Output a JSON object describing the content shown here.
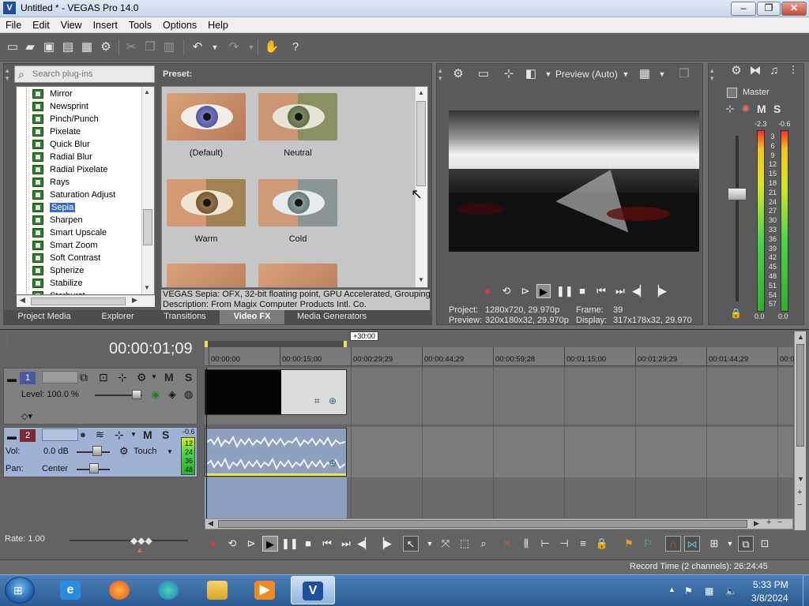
{
  "window": {
    "title": "Untitled * - VEGAS Pro 14.0",
    "app_icon": "vegas-icon",
    "minimize": "–",
    "maximize": "❐",
    "close": "✕"
  },
  "menu": [
    "File",
    "Edit",
    "View",
    "Insert",
    "Tools",
    "Options",
    "Help"
  ],
  "toolbar": {
    "icons": [
      "new-icon",
      "open-icon",
      "save-icon",
      "save-as-icon",
      "render-icon",
      "properties-icon",
      "cut-icon",
      "copy-icon",
      "paste-icon",
      "undo-icon",
      "redo-icon",
      "split-icon",
      "help-icon"
    ]
  },
  "plugins": {
    "search_placeholder": "Search plug-ins",
    "items": [
      "Mirror",
      "Newsprint",
      "Pinch/Punch",
      "Pixelate",
      "Quick Blur",
      "Radial Blur",
      "Radial Pixelate",
      "Rays",
      "Saturation Adjust",
      "Sepia",
      "Sharpen",
      "Smart Upscale",
      "Smart Zoom",
      "Soft Contrast",
      "Spherize",
      "Stabilize",
      "Starburst"
    ],
    "selected": "Sepia",
    "preset_label": "Preset:",
    "presets": [
      {
        "name": "(Default)"
      },
      {
        "name": "Neutral"
      },
      {
        "name": "Warm"
      },
      {
        "name": "Cold"
      }
    ],
    "info_line1": "VEGAS Sepia: OFX, 32-bit floating point, GPU Accelerated, Grouping V",
    "info_line2": "Description: From Magix Computer Products Intl. Co."
  },
  "tabs": [
    {
      "label": "Project Media",
      "active": false
    },
    {
      "label": "Explorer",
      "active": false
    },
    {
      "label": "Transitions",
      "active": false
    },
    {
      "label": "Video FX",
      "active": true
    },
    {
      "label": "Media Generators",
      "active": false
    }
  ],
  "preview": {
    "mode": "Preview (Auto)",
    "project_label": "Project:",
    "project_value": "1280x720, 29.970p",
    "preview_label": "Preview:",
    "preview_value": "320x180x32, 29.970p",
    "frame_label": "Frame:",
    "frame_value": "39",
    "display_label": "Display:",
    "display_value": "317x178x32, 29.970"
  },
  "master": {
    "label": "Master",
    "mute": "M",
    "solo": "S",
    "peak_left": "-2.3",
    "peak_right": "-0.6",
    "scale": [
      "3",
      "6",
      "9",
      "12",
      "15",
      "18",
      "21",
      "24",
      "27",
      "30",
      "33",
      "36",
      "39",
      "42",
      "45",
      "48",
      "51",
      "54",
      "57"
    ],
    "floor_left": "0.0",
    "floor_right": "0.0"
  },
  "timeline": {
    "current_time": "00:00:01;09",
    "loop_length": "+30:00",
    "ruler": [
      "00:00:00",
      "00:00:15;00",
      "00:00:29;29",
      "00:00:44;29",
      "00:00:59;28",
      "00:01:15;00",
      "00:01:29;29",
      "00:01:44;29",
      "00:0"
    ],
    "track1": {
      "number": "1",
      "mute": "M",
      "solo": "S",
      "level_label": "Level: 100.0 %"
    },
    "track2": {
      "number": "2",
      "mute": "M",
      "solo": "S",
      "vol_label": "Vol:",
      "vol_value": "0.0 dB",
      "pan_label": "Pan:",
      "pan_value": "Center",
      "automation": "Touch",
      "meter_peak": "-0.6",
      "meter_scale": [
        "12",
        "24",
        "36",
        "48"
      ]
    },
    "rate_label": "Rate: 1.00",
    "record_time": "Record Time (2 channels): 26:24:45"
  },
  "taskbar": {
    "time": "5:33 PM",
    "date": "3/8/2024",
    "apps": [
      "internet-explorer-icon",
      "firefox-icon",
      "edge-icon",
      "file-explorer-icon",
      "media-player-icon",
      "vegas-pro-icon"
    ]
  },
  "colors": {
    "panel_bg": "#5a5a5a",
    "selection": "#3a6cc6",
    "meter_green": "#2fb02f",
    "meter_red": "#ff2a2a",
    "loop_marker": "#e8e84a"
  }
}
